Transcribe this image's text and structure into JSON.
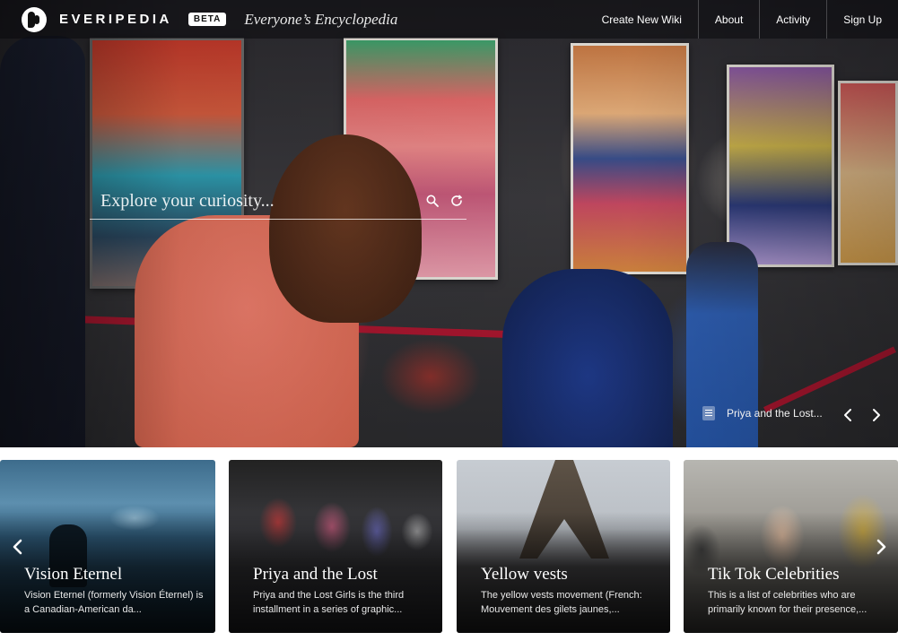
{
  "header": {
    "brand": "EVERIPEDIA",
    "badge": "BETA",
    "tagline": "Everyone’s Encyclopedia",
    "nav": [
      {
        "label": "Create New Wiki"
      },
      {
        "label": "About"
      },
      {
        "label": "Activity"
      },
      {
        "label": "Sign Up"
      }
    ]
  },
  "search": {
    "placeholder": "Explore your curiosity..."
  },
  "hero": {
    "caption": "Priya and the Lost..."
  },
  "cards": [
    {
      "title": "Vision Eternel",
      "description": "Vision Eternel (formerly Vision Éternel) is a Canadian-American da..."
    },
    {
      "title": "Priya and the Lost",
      "description": "Priya and the Lost Girls is the third installment in a series of graphic..."
    },
    {
      "title": "Yellow vests",
      "description": "The yellow vests movement (French: Mouvement des gilets jaunes,..."
    },
    {
      "title": "Tik Tok Celebrities",
      "description": "This is a list of celebrities who are primarily known for their presence,..."
    }
  ],
  "colors": {
    "rope": "#c8102e",
    "topbar": "#0a0a0c",
    "text": "#ffffff"
  },
  "icons": [
    "logo-icon",
    "search-icon",
    "refresh-icon",
    "document-icon",
    "chevron-left-icon",
    "chevron-right-icon"
  ]
}
